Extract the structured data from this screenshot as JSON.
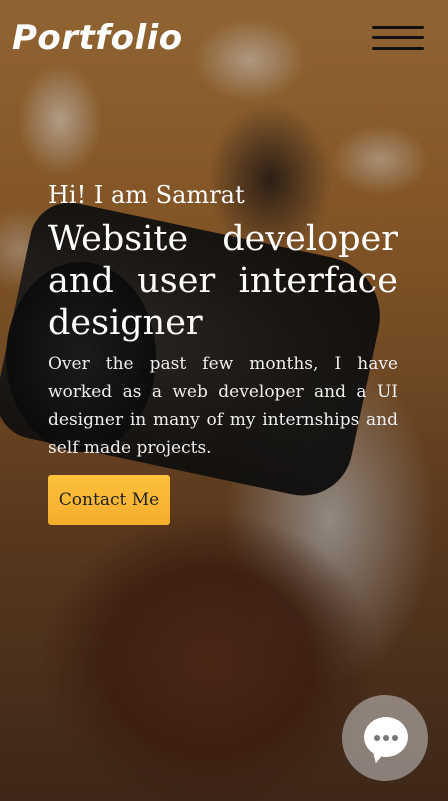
{
  "header": {
    "logo_text": "Portfolio",
    "menu_icon": "hamburger-menu-icon"
  },
  "hero": {
    "greeting": "Hi! I am Samrat",
    "headline": "Website developer and user interface designer",
    "bio": "Over the past few months, I have worked as a web developer and a UI designer in many of my internships and self made projects.",
    "cta_label": "Contact Me"
  },
  "chat": {
    "icon": "chat-bubble-icon"
  },
  "colors": {
    "accent": "#f7b733",
    "text": "#ffffff",
    "menu_bars": "#111111"
  }
}
